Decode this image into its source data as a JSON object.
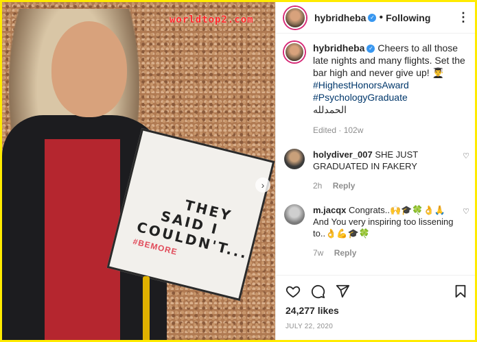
{
  "watermark": "worldtop2.com",
  "cap": {
    "line1": "THEY",
    "line2": "SAID I",
    "line3": "COULDN'T...",
    "tag": "#BEMORE"
  },
  "header": {
    "username": "hybridheba",
    "following": "Following",
    "more": "⋮"
  },
  "caption": {
    "username": "hybridheba",
    "text": "Cheers to all those late nights and many flights. Set the bar high and never give up! 👨‍🎓",
    "tags": [
      "#HighestHonorsAward",
      "#PsychologyGraduate"
    ],
    "arabic": "الحمدلله",
    "meta": "Edited · 102w"
  },
  "comments": [
    {
      "username": "holydiver_007",
      "text": "SHE JUST GRADUATED IN FAKERY",
      "time": "2h",
      "reply": "Reply"
    },
    {
      "username": "m.jacqx",
      "text": "Congrats..🙌🎓🍀👌🙏 And You very inspiring too lissening to..👌💪🎓🍀",
      "time": "7w",
      "reply": "Reply"
    }
  ],
  "likes": "24,277 likes",
  "date": "JULY 22, 2020",
  "icons": [
    "heart-icon",
    "comment-icon",
    "share-icon",
    "bookmark-icon",
    "chevron-right-icon",
    "verified-icon",
    "more-icon"
  ],
  "colors": {
    "frame": "#ffeb00",
    "link": "#00376b",
    "verified": "#3897f0",
    "muted": "#8e8e8e"
  }
}
